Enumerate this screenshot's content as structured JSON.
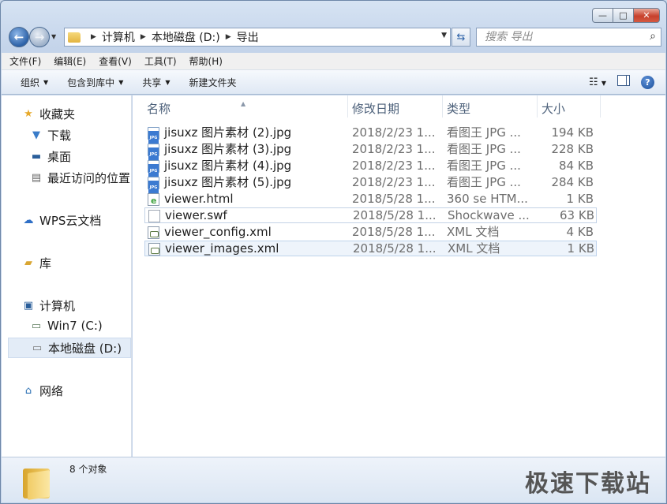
{
  "window": {
    "minimize_glyph": "—",
    "maximize_glyph": "□",
    "close_glyph": "✕"
  },
  "address": {
    "crumbs": [
      "计算机",
      "本地磁盘 (D:)",
      "导出"
    ]
  },
  "search": {
    "placeholder": "搜索 导出"
  },
  "menu": [
    "文件(F)",
    "编辑(E)",
    "查看(V)",
    "工具(T)",
    "帮助(H)"
  ],
  "toolbar": {
    "organize": "组织",
    "include_library": "包含到库中",
    "share": "共享",
    "new_folder": "新建文件夹"
  },
  "nav": {
    "favorites": "收藏夹",
    "downloads": "下载",
    "desktop": "桌面",
    "recent": "最近访问的位置",
    "wps": "WPS云文档",
    "library": "库",
    "computer": "计算机",
    "win7": "Win7 (C:)",
    "local_d": "本地磁盘 (D:)",
    "network": "网络"
  },
  "columns": {
    "name": "名称",
    "date": "修改日期",
    "type": "类型",
    "size": "大小"
  },
  "files": [
    {
      "name": "jisuxz 图片素材 (2).jpg",
      "date": "2018/2/23 1...",
      "type": "看图王 JPG ...",
      "size": "194 KB",
      "icon": "jpg"
    },
    {
      "name": "jisuxz 图片素材 (3).jpg",
      "date": "2018/2/23 1...",
      "type": "看图王 JPG ...",
      "size": "228 KB",
      "icon": "jpg"
    },
    {
      "name": "jisuxz 图片素材 (4).jpg",
      "date": "2018/2/23 1...",
      "type": "看图王 JPG ...",
      "size": "84 KB",
      "icon": "jpg"
    },
    {
      "name": "jisuxz 图片素材 (5).jpg",
      "date": "2018/2/23 1...",
      "type": "看图王 JPG ...",
      "size": "284 KB",
      "icon": "jpg"
    },
    {
      "name": "viewer.html",
      "date": "2018/5/28 1...",
      "type": "360 se HTM...",
      "size": "1 KB",
      "icon": "html"
    },
    {
      "name": "viewer.swf",
      "date": "2018/5/28 1...",
      "type": "Shockwave ...",
      "size": "63 KB",
      "icon": "swf"
    },
    {
      "name": "viewer_config.xml",
      "date": "2018/5/28 1...",
      "type": "XML 文档",
      "size": "4 KB",
      "icon": "xml"
    },
    {
      "name": "viewer_images.xml",
      "date": "2018/5/28 1...",
      "type": "XML 文档",
      "size": "1 KB",
      "icon": "xml"
    }
  ],
  "status": {
    "count": "8 个对象"
  },
  "watermark": "极速下载站"
}
